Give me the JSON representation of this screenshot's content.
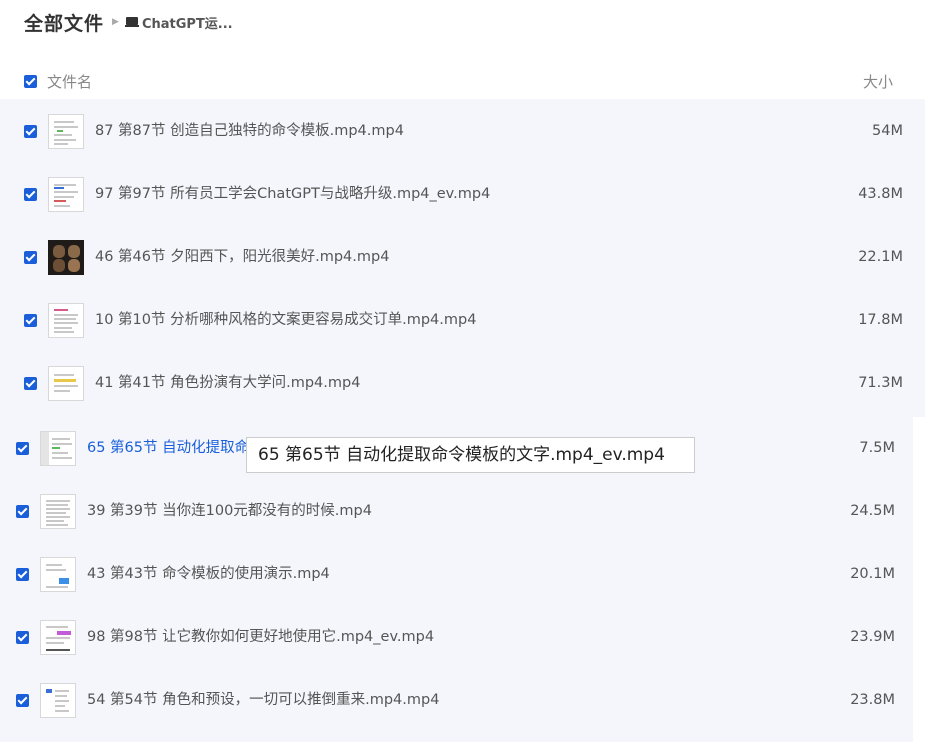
{
  "breadcrumb": {
    "root": "全部文件",
    "current": "ChatGPT运..."
  },
  "header": {
    "name_col": "文件名",
    "size_col": "大小"
  },
  "files": [
    {
      "name": "87 第87节 创造自己独特的命令模板.mp4.mp4",
      "size": "54M"
    },
    {
      "name": "97 第97节 所有员工学会ChatGPT与战略升级.mp4_ev.mp4",
      "size": "43.8M"
    },
    {
      "name": "46 第46节 夕阳西下，阳光很美好.mp4.mp4",
      "size": "22.1M"
    },
    {
      "name": "10 第10节 分析哪种风格的文案更容易成交订单.mp4.mp4",
      "size": "17.8M"
    },
    {
      "name": "41 第41节 角色扮演有大学问.mp4.mp4",
      "size": "71.3M"
    },
    {
      "name": "65 第65节 自动化提取命令模板的文字.mp4_ev.mp4",
      "size": "7.5M"
    },
    {
      "name": "39 第39节 当你连100元都没有的时候.mp4",
      "size": "24.5M"
    },
    {
      "name": "43 第43节 命令模板的使用演示.mp4",
      "size": "20.1M"
    },
    {
      "name": "98 第98节 让它教你如何更好地使用它.mp4_ev.mp4",
      "size": "23.9M"
    },
    {
      "name": "54 第54节 角色和预设，一切可以推倒重来.mp4.mp4",
      "size": "23.8M"
    }
  ],
  "tooltip": "65 第65节  自动化提取命令模板的文字.mp4_ev.mp4",
  "colors": {
    "accent": "#1a5fd9",
    "row_background": "#f4f6fc"
  }
}
